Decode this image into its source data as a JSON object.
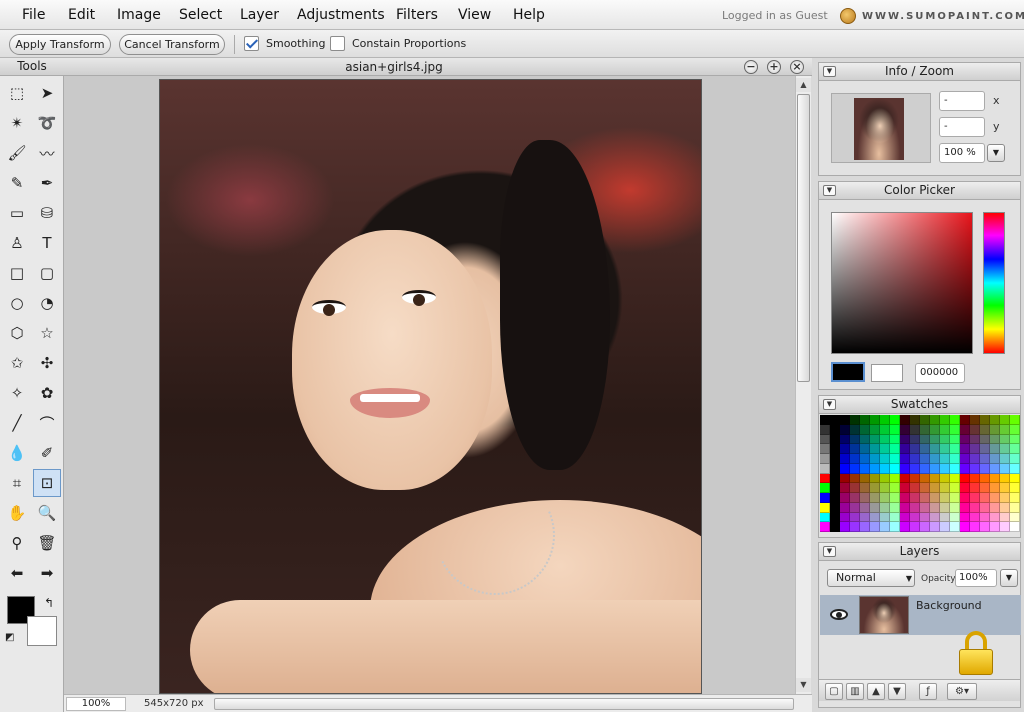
{
  "menubar": {
    "items": [
      "File",
      "Edit",
      "Image",
      "Select",
      "Layer",
      "Adjustments",
      "Filters",
      "View",
      "Help"
    ],
    "login_status": "Logged in as Guest",
    "brand": "WWW.SUMOPAINT.COM"
  },
  "toolbar": {
    "apply_label": "Apply Transform",
    "cancel_label": "Cancel Transform",
    "smoothing_label": "Smoothing",
    "smoothing_checked": true,
    "constrain_label": "Constain Proportions",
    "constrain_checked": false
  },
  "tools": {
    "title": "Tools",
    "items": [
      "marquee-icon",
      "move-arrow-icon",
      "magic-wand-icon",
      "lasso-icon",
      "brush-icon",
      "smudge-brush-icon",
      "pencil-icon",
      "pen-icon",
      "gradient-icon",
      "paint-bucket-icon",
      "clone-stamp-icon",
      "text-icon",
      "rectangle-icon",
      "rounded-rectangle-icon",
      "ellipse-icon",
      "pie-shape-icon",
      "hexagon-icon",
      "star-icon",
      "burst-icon",
      "puzzle-icon",
      "blob-shape-icon",
      "flower-icon",
      "line-icon",
      "curve-icon",
      "blur-drop-icon",
      "dropper-pen-icon",
      "crop-icon",
      "transform-icon",
      "hand-icon",
      "zoom-icon",
      "eyedropper-icon",
      "trash-icon",
      "arrow-left-icon",
      "arrow-right-icon"
    ],
    "selected_index": 27,
    "foreground_color": "#000000",
    "background_color": "#ffffff"
  },
  "document": {
    "title": "asian+girls4.jpg",
    "zoom": "100%",
    "size": "545x720 px"
  },
  "info_zoom": {
    "title": "Info / Zoom",
    "x_value": "-",
    "y_value": "-",
    "x_label": "x",
    "y_label": "y",
    "zoom_value": "100 %"
  },
  "color_picker": {
    "title": "Color Picker",
    "hex_value": "000000",
    "hue_color": "#e8141b"
  },
  "swatches": {
    "title": "Swatches"
  },
  "layers": {
    "title": "Layers",
    "blend_mode": "Normal",
    "opacity_label": "Opacity:",
    "opacity_value": "100%",
    "items": [
      {
        "name": "Background",
        "visible": true,
        "locked": true
      }
    ]
  }
}
